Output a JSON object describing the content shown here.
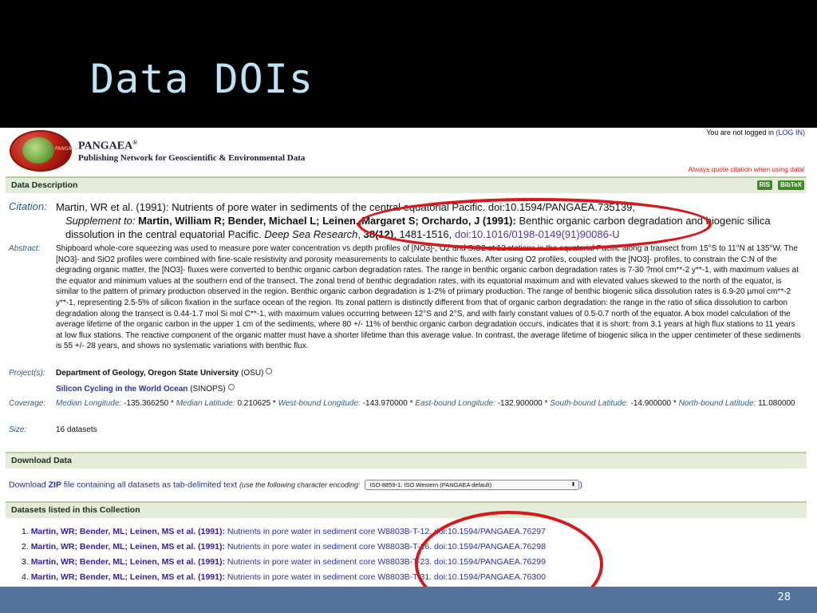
{
  "slide": {
    "title": "Data DOIs",
    "page_number": "28"
  },
  "pangaea": {
    "brand": "PANGAEA",
    "brand_mark": "®",
    "logo_tag": "PANGAEA",
    "tagline": "Publishing Network for Geoscientific & Environmental Data",
    "login_text": "You are not logged in",
    "login_link": "(LOG IN)",
    "quote_note": "Always quote citation when using data!"
  },
  "data_description": {
    "header": "Data Description",
    "ris_label": "RIS",
    "bibtex_label": "BibTeX",
    "citation_label": "Citation:",
    "citation_line1": "Martin, WR et al. (1991): Nutrients of pore water in sediments of the central equatorial Pacific. doi:10.1594/PANGAEA.735139,",
    "supplement_prefix": "Supplement to:",
    "supplement_authors": "Martin, William R; Bender, Michael L; Leinen, Margaret S; Orchardo, J (1991):",
    "supplement_title": "Benthic organic carbon degradation and biogenic silica dissolution in the central equatorial Pacific.",
    "journal": "Deep Sea Research",
    "volume": "38(12)",
    "pages": ", 1481-1516,",
    "article_doi": "doi:10.1016/0198-0149(91)90086-U",
    "abstract_label": "Abstract:",
    "abstract": "Shipboard whole-core squeezing was used to measure pore water concentration vs depth profiles of [NO3]-, O2 and SiO2 at 12 stations in the equatorial Pacific along a transect from 15°S to 11°N at 135°W. The [NO3]- and SiO2 profiles were combined with fine-scale resistivity and porosity measurements to calculate benthic fluxes. After using O2 profiles, coupled with the [NO3]- profiles, to constrain the C:N of the degrading organic matter, the [NO3]- fluxes were converted to benthic organic carbon degradation rates. The range in benthic organic carbon degradation rates is 7-30 ?mol cm**-2 y**-1, with maximum values at the equator and minimum values at the southern end of the transect. The zonal trend of benthic degradation rates, with its equatorial maximum and with elevated values skewed to the north of the equator, is similar to the pattern of primary production observed in the region. Benthic organic carbon degradation is 1-2% of primary production. The range of benthic biogenic silica dissolution rates is 6.9-20 µmol cm**-2 y**-1, representing 2.5-5% of silicon fixation in the surface ocean of the region. Its zonal pattern is distinctly different from that of organic carbon degradation: the range in the ratio of silica dissolution to carbon degradation along the transect is 0.44-1.7 mol Si mol C**-1, with maximum values occurring between 12°S and 2°S, and with fairly constant values of 0.5-0.7 north of the equator. A box model calculation of the average lifetime of the organic carbon in the upper 1 cm of the sediments, where 80 +/- 11% of benthic organic carbon degradation occurs, indicates that it is short: from 3.1 years at high flux stations to 11 years at low flux stations. The reactive component of the organic matter must have a shorter lifetime than this average value. In contrast, the average lifetime of biogenic silica in the upper centimeter of these sediments is 55 +/- 28 years, and shows no systematic variations with benthic flux.",
    "projects_label": "Project(s):",
    "project1_name": "Department of Geology, Oregon State University",
    "project1_abbr": "(OSU)",
    "project2_name": "Silicon Cycling in the World Ocean",
    "project2_abbr": "(SINOPS)",
    "coverage_label": "Coverage:",
    "coverage": [
      {
        "label": "Median Longitude:",
        "value": "-135.366250 *"
      },
      {
        "label": "Median Latitude:",
        "value": "0.210625 *"
      },
      {
        "label": "West-bound Longitude:",
        "value": "-143.970000 *"
      },
      {
        "label": "East-bound Longitude:",
        "value": "-132.900000 *"
      },
      {
        "label": "South-bound Latitude:",
        "value": "-14.900000 *"
      },
      {
        "label": "North-bound Latitude:",
        "value": "11.080000"
      }
    ],
    "size_label": "Size:",
    "size": "16 datasets"
  },
  "download": {
    "header": "Download Data",
    "prefix": "Download",
    "zip": "ZIP",
    "suffix": "file containing all datasets as tab-delimited text",
    "encoding_note": "(use the following character encoding:",
    "encoding_value": "ISO-8859-1: ISO Western (PANGAEA default)",
    "close": ")"
  },
  "datasets": {
    "header": "Datasets listed in this Collection",
    "items": [
      {
        "num": "1.",
        "authors": "Martin, WR; Bender, ML; Leinen, MS et al. (1991):",
        "title": "Nutrients in pore water in sediment core W8803B-T-12.",
        "doi": "doi:10.1594/PANGAEA.76297"
      },
      {
        "num": "2.",
        "authors": "Martin, WR; Bender, ML; Leinen, MS et al. (1991):",
        "title": "Nutrients in pore water in sediment core W8803B-T-16.",
        "doi": "doi:10.1594/PANGAEA.76298"
      },
      {
        "num": "3.",
        "authors": "Martin, WR; Bender, ML; Leinen, MS et al. (1991):",
        "title": "Nutrients in pore water in sediment core W8803B-T-23.",
        "doi": "doi:10.1594/PANGAEA.76299"
      },
      {
        "num": "4.",
        "authors": "Martin, WR; Bender, ML; Leinen, MS et al. (1991):",
        "title": "Nutrients in pore water in sediment core W8803B-T-31.",
        "doi": "doi:10.1594/PANGAEA.76300"
      }
    ]
  },
  "colors": {
    "annotation_red": "#d41a1a",
    "footer_blue": "#52739e",
    "title_blue": "#bfe3f6"
  }
}
